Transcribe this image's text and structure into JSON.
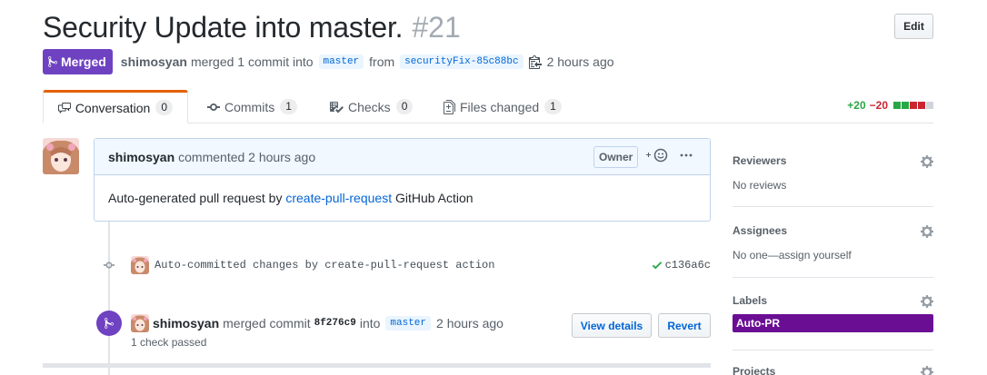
{
  "header": {
    "title": "Security Update into master.",
    "number": "#21",
    "edit_label": "Edit"
  },
  "meta": {
    "state": "Merged",
    "author": "shimosyan",
    "action": "merged 1 commit into",
    "base_branch": "master",
    "from_word": "from",
    "head_branch": "securityFix-85c88bc",
    "time": "2 hours ago"
  },
  "tabs": [
    {
      "label": "Conversation",
      "count": "0",
      "icon": "comment-discussion-icon"
    },
    {
      "label": "Commits",
      "count": "1",
      "icon": "git-commit-icon"
    },
    {
      "label": "Checks",
      "count": "0",
      "icon": "checklist-icon"
    },
    {
      "label": "Files changed",
      "count": "1",
      "icon": "file-diff-icon"
    }
  ],
  "diffstat": {
    "additions": "+20",
    "deletions": "−20",
    "colors": [
      "#28a745",
      "#28a745",
      "#cb2431",
      "#cb2431",
      "#d1d5da"
    ]
  },
  "comment": {
    "author": "shimosyan",
    "action": "commented 2 hours ago",
    "badge": "Owner",
    "body_prefix": "Auto-generated pull request by ",
    "body_link": "create-pull-request",
    "body_suffix": " GitHub Action"
  },
  "commit": {
    "message": "Auto-committed changes by create-pull-request action",
    "sha": "c136a6c",
    "status": "success"
  },
  "merge_event": {
    "author": "shimosyan",
    "action": "merged commit",
    "sha": "8f276c9",
    "into": "into",
    "branch": "master",
    "time": "2 hours ago",
    "checks": "1 check passed",
    "view_details": "View details",
    "revert": "Revert"
  },
  "sidebar": {
    "reviewers": {
      "heading": "Reviewers",
      "value": "No reviews"
    },
    "assignees": {
      "heading": "Assignees",
      "value": "No one—assign yourself"
    },
    "labels": {
      "heading": "Labels",
      "items": [
        "Auto-PR"
      ],
      "color": "#6a0e94"
    },
    "projects": {
      "heading": "Projects"
    }
  },
  "colors": {
    "merged": "#6f42c1",
    "link": "#0366d6",
    "accent_tab": "#e36209"
  }
}
